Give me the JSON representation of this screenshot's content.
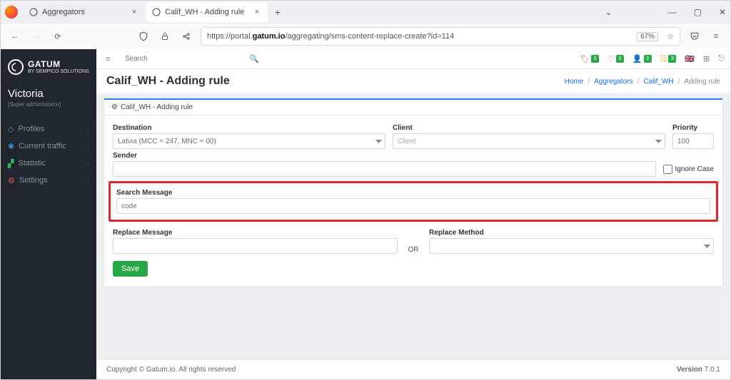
{
  "browser": {
    "tabs": [
      {
        "title": "Aggregators"
      },
      {
        "title": "Calif_WH - Adding rule"
      }
    ],
    "url_prefix": "https://portal.",
    "url_host": "gatum.io",
    "url_path": "/aggregating/sms-content-replace-create?id=114",
    "zoom": "67%"
  },
  "sidebar": {
    "brand_big": "GATUM",
    "brand_small": "BY SEMPICO SOLUTIONS",
    "user": "Victoria",
    "role": "[Super administrator]",
    "items": [
      {
        "label": "Profiles"
      },
      {
        "label": "Current traffic"
      },
      {
        "label": "Statistic"
      },
      {
        "label": "Settings"
      }
    ]
  },
  "topbar": {
    "search_placeholder": "Search",
    "badges": [
      "3",
      "3",
      "3",
      "3"
    ]
  },
  "page": {
    "title": "Calif_WH - Adding rule",
    "breadcrumb": {
      "home": "Home",
      "aggregators": "Aggregators",
      "calif": "Calif_WH",
      "current": "Adding rule"
    },
    "panel_title": "Calif_WH - Adding rule",
    "labels": {
      "destination": "Destination",
      "client": "Client",
      "priority": "Priority",
      "sender": "Sender",
      "ignore_case": "Ignore Case",
      "search_message": "Search Message",
      "replace_message": "Replace Message",
      "or": "OR",
      "replace_method": "Replace Method",
      "save": "Save"
    },
    "values": {
      "destination": "Latvia (MCC = 247, MNC = 00)",
      "client_placeholder": "Client",
      "priority": "100",
      "search_message": "code"
    }
  },
  "footer": {
    "copyright": "Copyright © Gatum.io. All rights reserved",
    "version_label": "Version ",
    "version": "7.0.1"
  }
}
